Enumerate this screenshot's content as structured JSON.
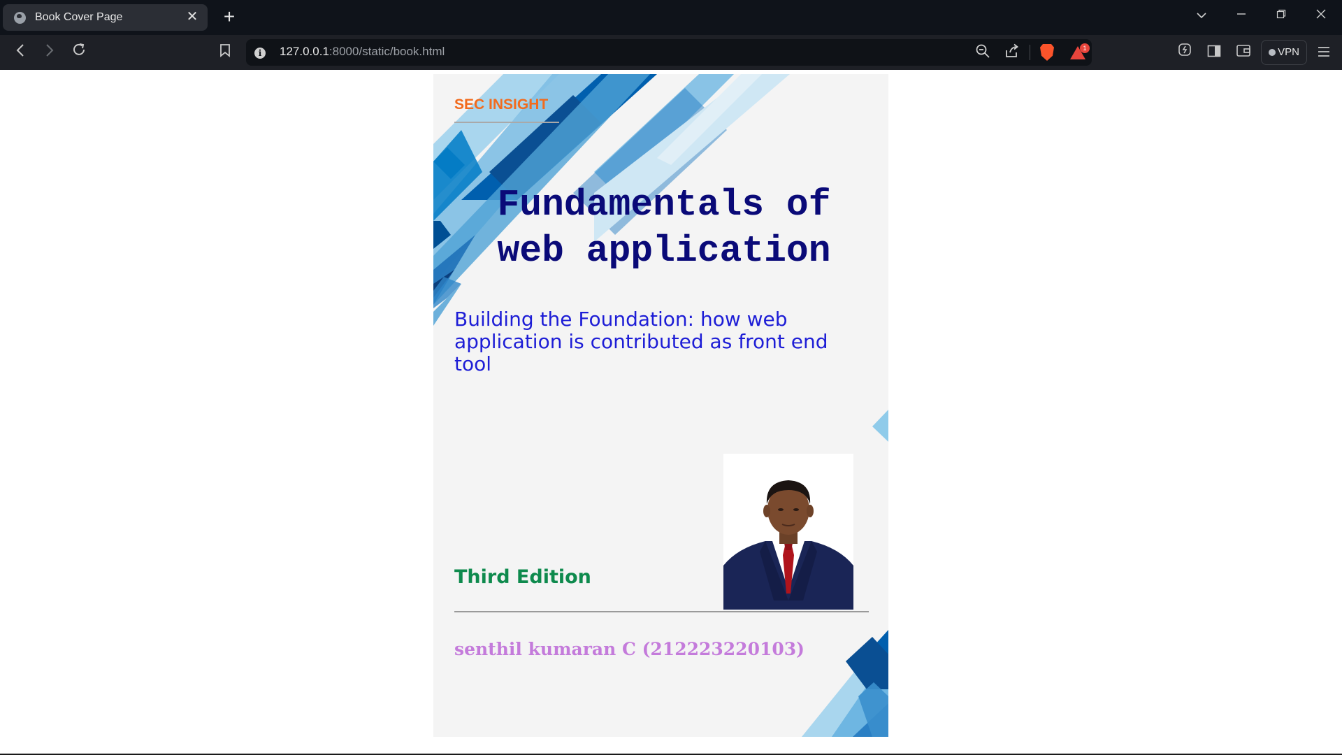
{
  "browser": {
    "tab_title": "Book Cover Page",
    "tab_close": "✕",
    "new_tab": "+",
    "url_host": "127.0.0.1",
    "url_path": ":8000/static/book.html",
    "vpn_label": "VPN",
    "notification_count": "1"
  },
  "cover": {
    "brand": "SEC INSIGHT",
    "title_line1": "Fundamentals of",
    "title_line2": "web application",
    "subtitle": "Building the Foundation: how web application is contributed as front end tool",
    "edition": "Third Edition",
    "author": "senthil kumaran C (212223220103)"
  },
  "colors": {
    "brand": "#f26b1d",
    "title": "#0a0a78",
    "subtitle": "#1d1dd6",
    "edition": "#0e8a4d",
    "author": "#c47bdb"
  },
  "icons": [
    "globe-icon",
    "close-icon",
    "plus-icon",
    "chevron-down-icon",
    "minimize-icon",
    "restore-icon",
    "back-icon",
    "forward-icon",
    "reload-icon",
    "bookmark-icon",
    "info-icon",
    "zoom-icon",
    "share-icon",
    "brave-shield-icon",
    "brave-rewards-icon",
    "leo-icon",
    "sidebar-icon",
    "wallet-icon",
    "menu-icon"
  ]
}
